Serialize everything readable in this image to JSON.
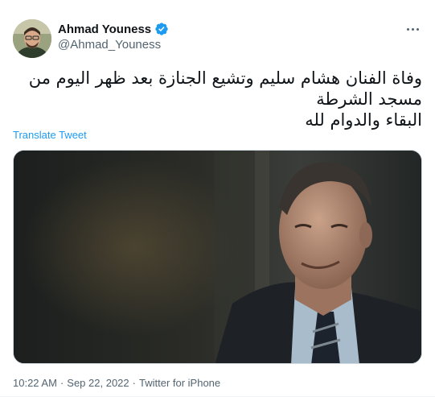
{
  "author": {
    "display_name": "Ahmad Youness",
    "handle": "@Ahmad_Youness",
    "verified": true
  },
  "icons": {
    "avatar": "avatar-photo",
    "verified": "verified-badge-icon",
    "more": "more-options-icon"
  },
  "tweet": {
    "lines": [
      "وفاة الفنان هشام سليم وتشيع الجنازة بعد ظهر اليوم من",
      "مسجد الشرطة",
      "البقاء والدوام لله"
    ],
    "translate_label": "Translate Tweet",
    "time": "10:22 AM",
    "separator": "·",
    "date": "Sep 22, 2022",
    "source": "Twitter for iPhone"
  },
  "colors": {
    "accent": "#1d9bf0",
    "secondary_text": "#536471",
    "primary_text": "#0f1419"
  }
}
